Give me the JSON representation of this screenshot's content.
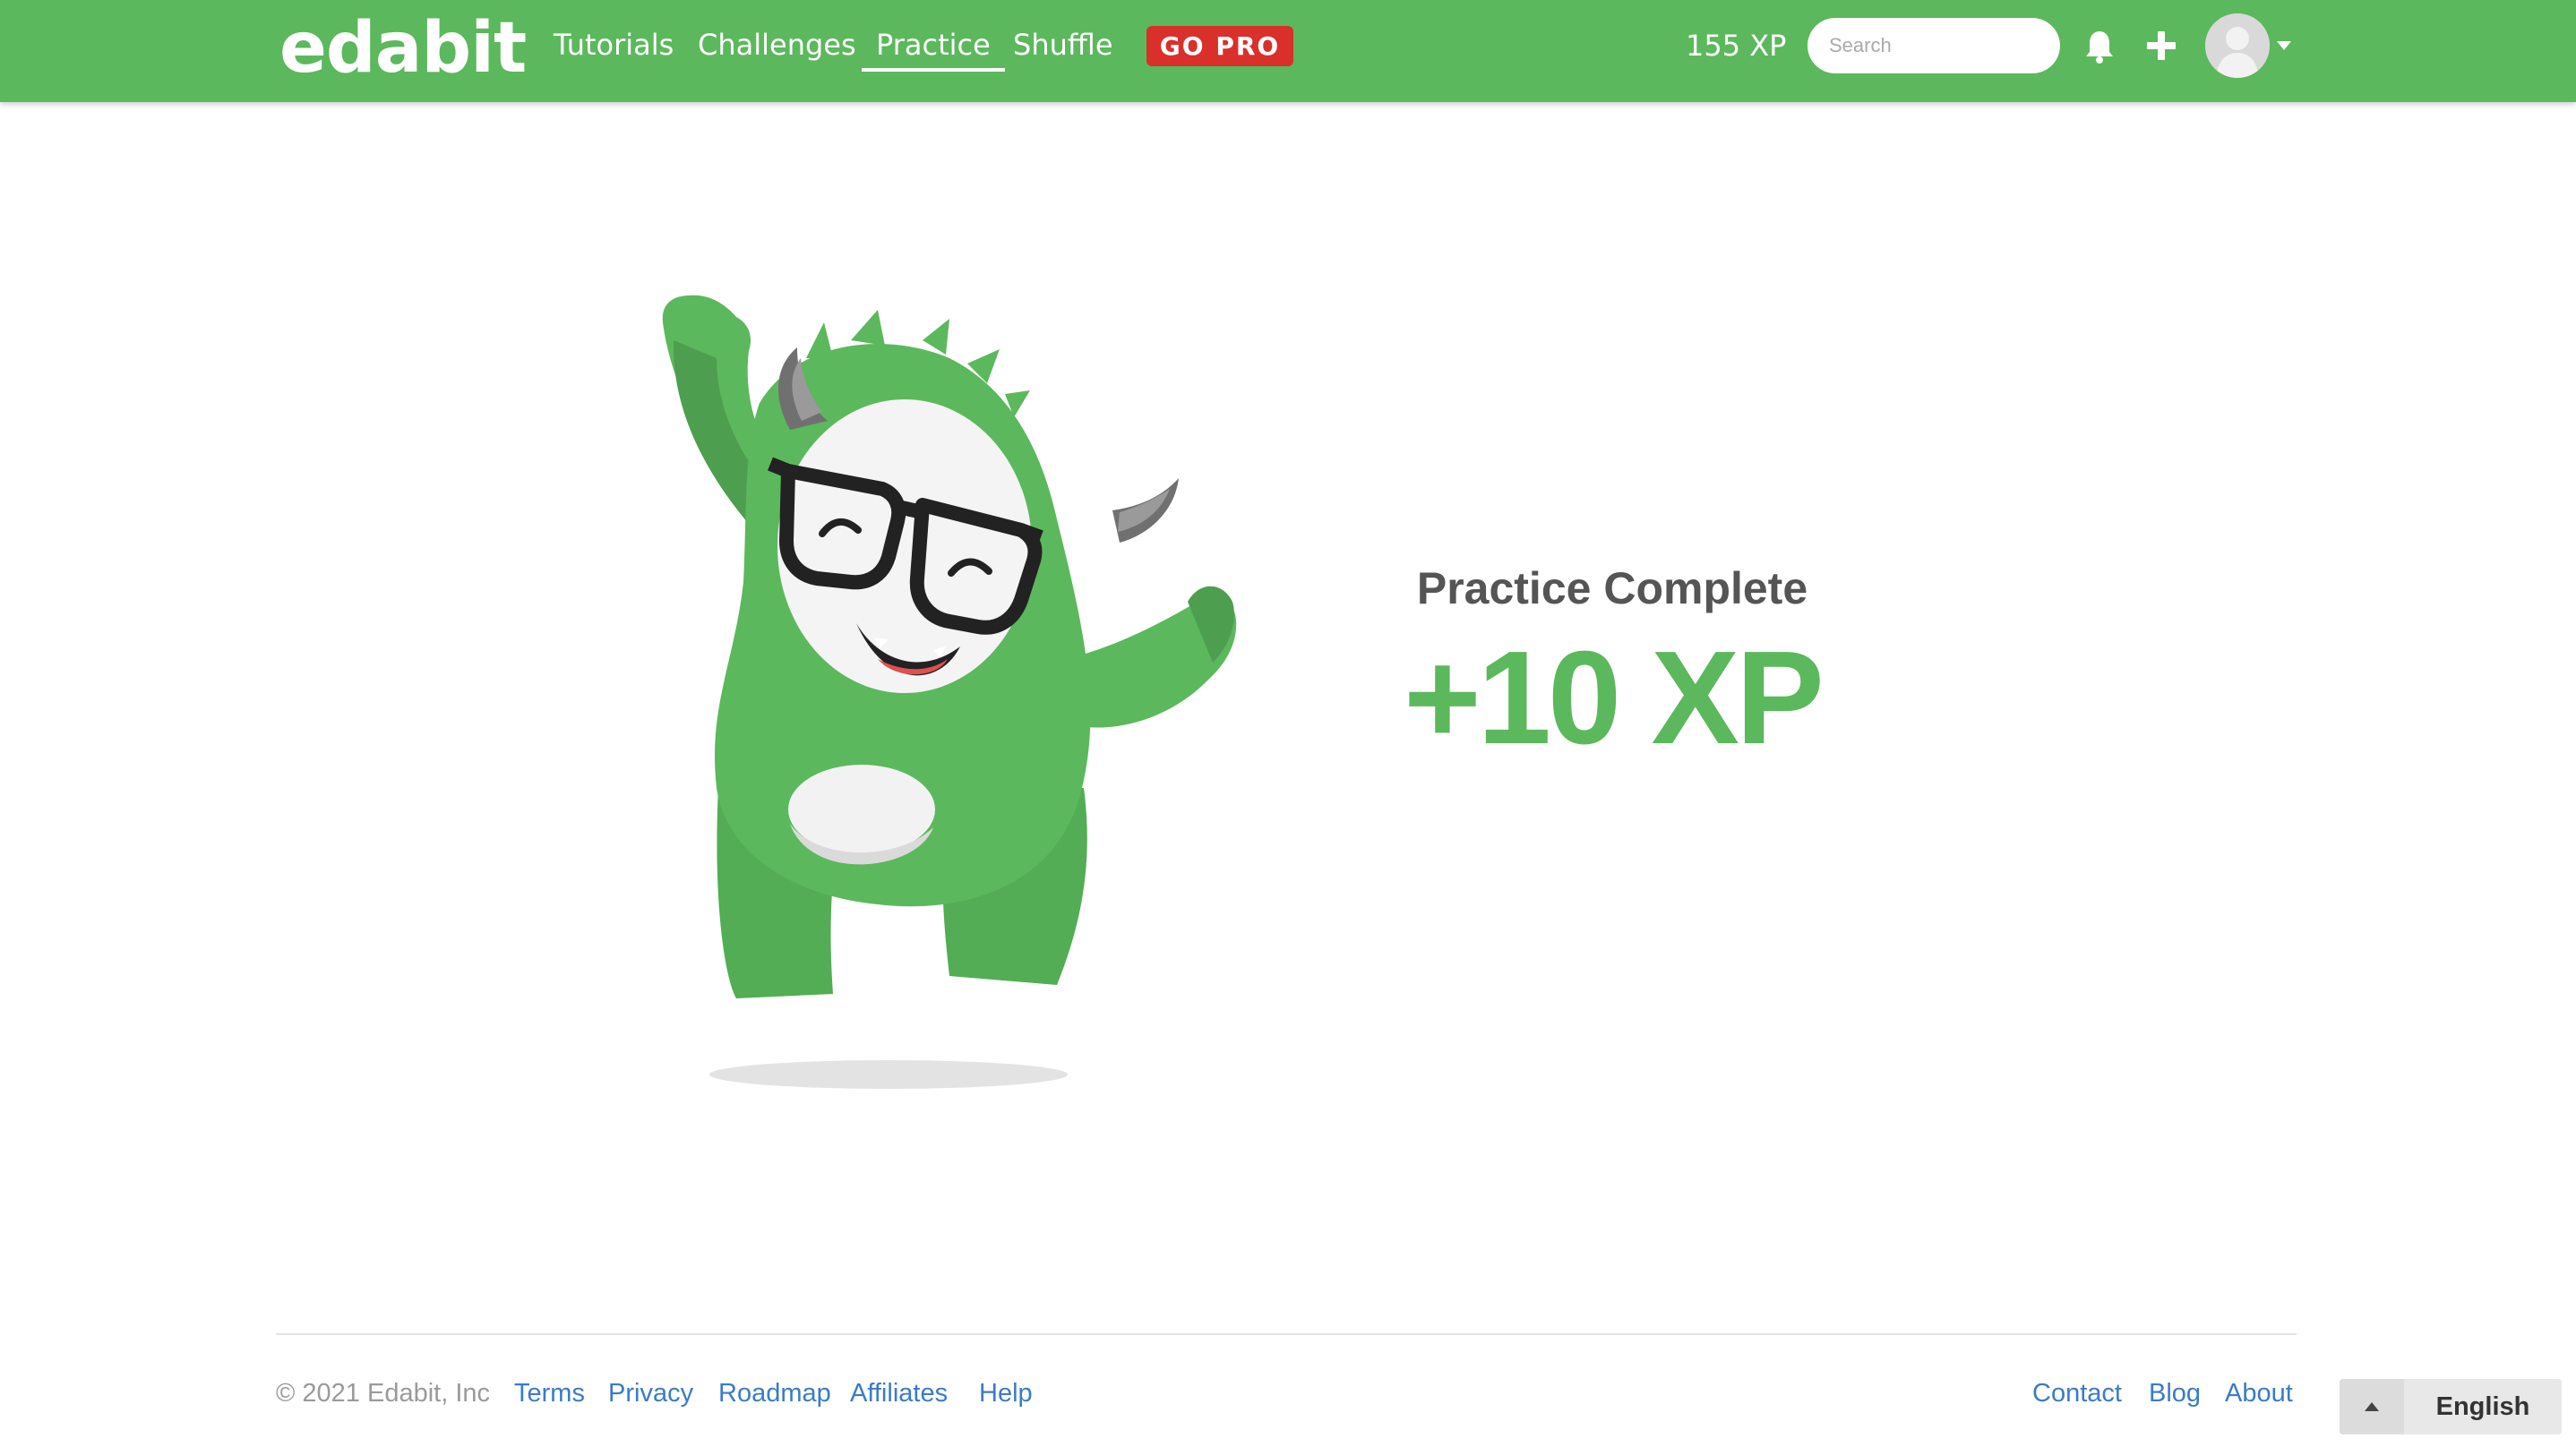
{
  "navbar": {
    "brand": "edabit",
    "links": [
      {
        "label": "Tutorials",
        "active": false
      },
      {
        "label": "Challenges",
        "active": false
      },
      {
        "label": "Practice",
        "active": true
      },
      {
        "label": "Shuffle",
        "active": false
      }
    ],
    "go_pro_label": "GO PRO",
    "xp_label": "155 XP",
    "search_placeholder": "Search",
    "icons": [
      "bell-icon",
      "plus-icon",
      "avatar",
      "caret-down-icon"
    ]
  },
  "main": {
    "title": "Practice Complete",
    "xp_award": "+10 XP",
    "mascot": "edabit-monster-mascot"
  },
  "footer": {
    "copyright": "© 2021 Edabit, Inc",
    "left_links": [
      "Terms",
      "Privacy",
      "Roadmap",
      "Affiliates",
      "Help"
    ],
    "right_links": [
      "Contact",
      "Blog",
      "About"
    ],
    "language": "English"
  },
  "colors": {
    "brand_green": "#5cb85c",
    "go_pro_red": "#d9302b",
    "link_blue": "#3a7bc8",
    "title_gray": "#555555"
  }
}
